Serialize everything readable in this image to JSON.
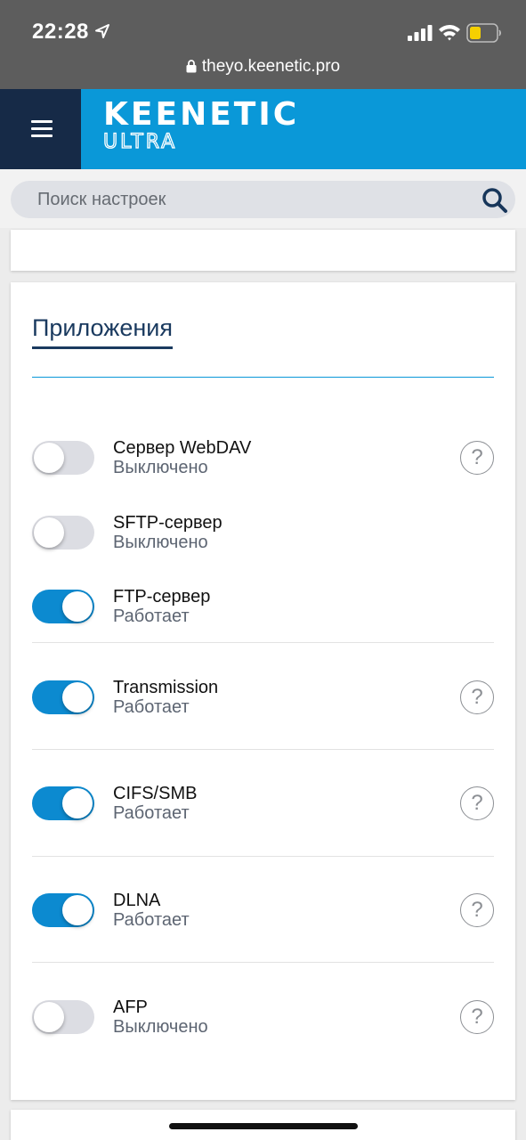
{
  "status_bar": {
    "time": "22:28",
    "url": "theyo.keenetic.pro"
  },
  "header": {
    "brand": "KEENETIC",
    "model": "ULTRA"
  },
  "search": {
    "placeholder": "Поиск настроек"
  },
  "section": {
    "title": "Приложения"
  },
  "apps": [
    {
      "name": "Сервер WebDAV",
      "status": "Выключено",
      "enabled": false,
      "help": true
    },
    {
      "name": "SFTP-сервер",
      "status": "Выключено",
      "enabled": false,
      "help": false
    },
    {
      "name": "FTP-сервер",
      "status": "Работает",
      "enabled": true,
      "help": false
    },
    {
      "name": "Transmission",
      "status": "Работает",
      "enabled": true,
      "help": true
    },
    {
      "name": "CIFS/SMB",
      "status": "Работает",
      "enabled": true,
      "help": true
    },
    {
      "name": "DLNA",
      "status": "Работает",
      "enabled": true,
      "help": true
    },
    {
      "name": "AFP",
      "status": "Выключено",
      "enabled": false,
      "help": true
    }
  ],
  "help_glyph": "?",
  "colors": {
    "accent": "#0a98d8",
    "nav_dark": "#162a47",
    "toggle_on": "#0c8ad0",
    "title": "#1a3a5f"
  }
}
